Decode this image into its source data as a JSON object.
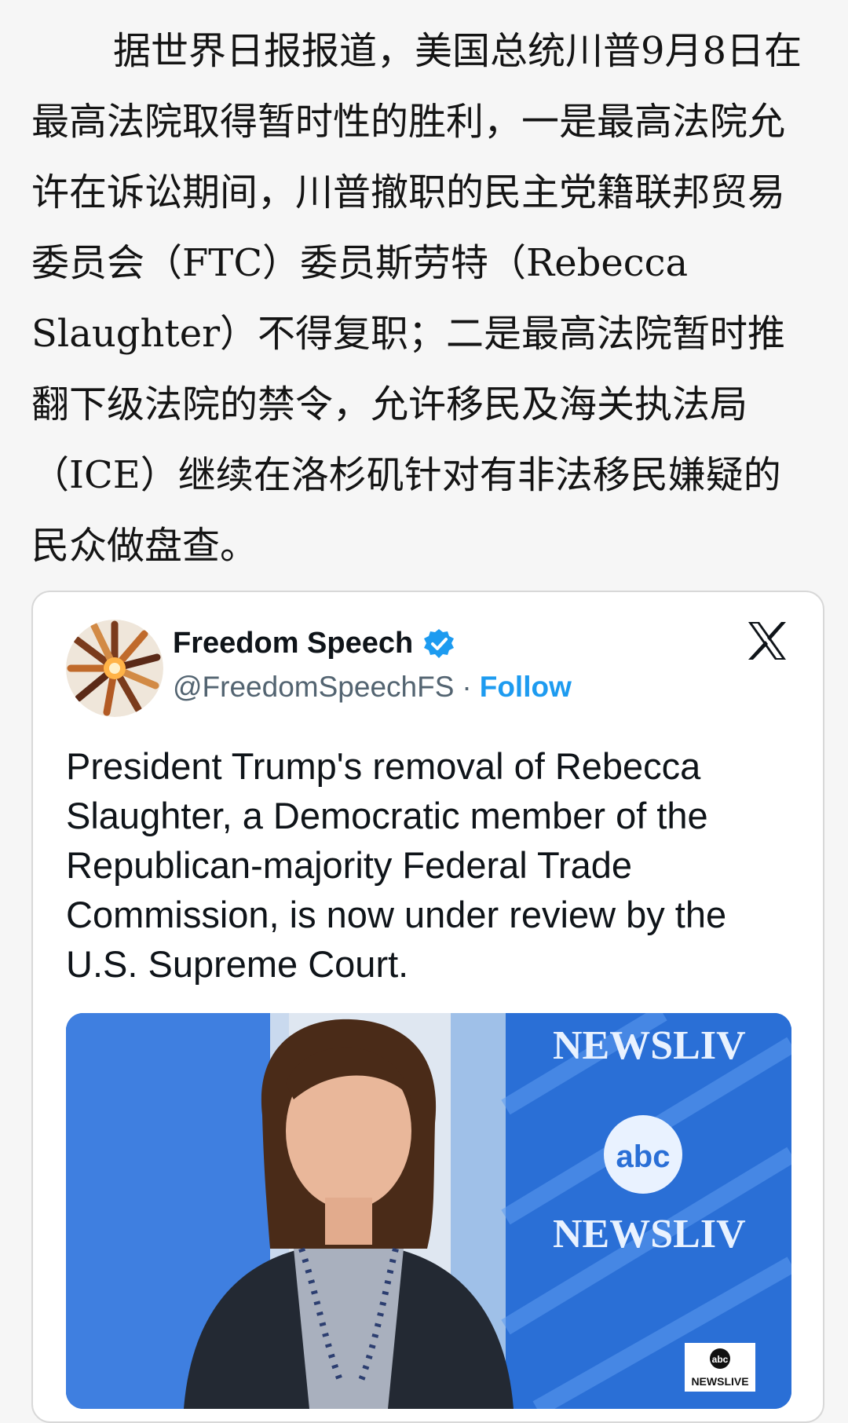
{
  "article": {
    "paragraph": "据世界日报报道，美国总统川普9月8日在最高法院取得暂时性的胜利，一是最高法院允许在诉讼期间，川普撤职的民主党籍联邦贸易委员会（FTC）委员斯劳特（Rebecca Slaughter）不得复职；二是最高法院暂时推翻下级法院的禁令，允许移民及海关执法局（ICE）继续在洛杉矶针对有非法移民嫌疑的民众做盘查。"
  },
  "tweet": {
    "author_name": "Freedom Speech",
    "handle": "@FreedomSpeechFS",
    "separator": "·",
    "follow_label": "Follow",
    "verified_icon": "verified-badge-icon",
    "platform_icon": "x-logo-icon",
    "text": "President Trump's removal of Rebecca Slaughter, a Democratic member of the Republican-majority Federal Trade Commission, is now under review by the U.S. Supreme Court.",
    "media": {
      "backdrop_text_top": "NEWSLIV",
      "backdrop_logo": "abc",
      "backdrop_text_bottom": "NEWSLIV",
      "bug_logo": "abc",
      "bug_text": "NEWSLIVE"
    }
  },
  "colors": {
    "page_background": "#f6f6f6",
    "follow_blue": "#1d9bf0",
    "verified_blue": "#1d9bf0",
    "studio_blue": "#2a6fd6"
  }
}
